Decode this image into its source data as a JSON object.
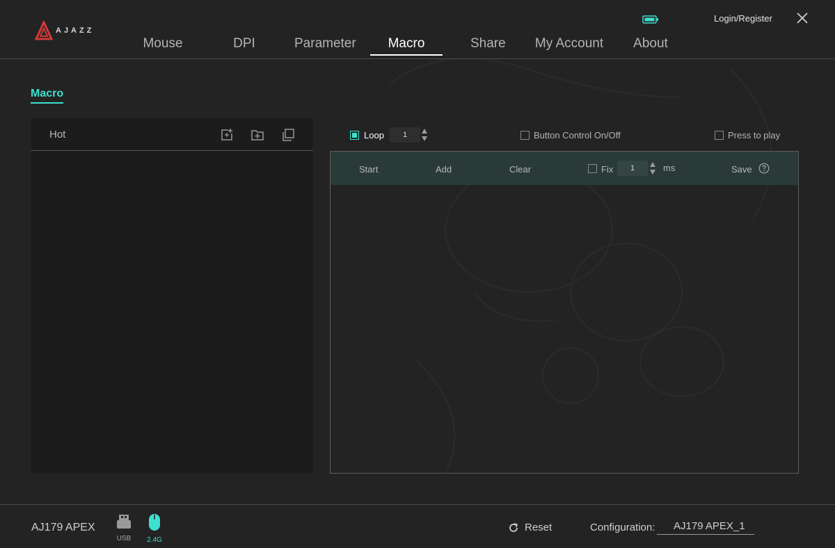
{
  "header": {
    "logo_text": "AJAZZ",
    "login_label": "Login/Register",
    "tabs": [
      {
        "label": "Mouse"
      },
      {
        "label": "DPI"
      },
      {
        "label": "Parameter"
      },
      {
        "label": "Macro",
        "active": true
      },
      {
        "label": "Share"
      },
      {
        "label": "My Account"
      },
      {
        "label": "About"
      }
    ]
  },
  "section": {
    "title": "Macro"
  },
  "macro_list": {
    "header": "Hot",
    "icons": [
      "add-macro-icon",
      "add-folder-icon",
      "copy-icon"
    ]
  },
  "options": {
    "loop_label": "Loop",
    "loop_checked": true,
    "loop_count": "1",
    "button_control_label": "Button Control On/Off",
    "button_control_checked": false,
    "press_to_play_label": "Press to play",
    "press_to_play_checked": false
  },
  "editor": {
    "start_label": "Start",
    "add_label": "Add",
    "clear_label": "Clear",
    "fix_label": "Fix",
    "fix_checked": false,
    "fix_value": "1",
    "unit_label": "ms",
    "save_label": "Save"
  },
  "footer": {
    "device_name": "AJ179 APEX",
    "usb_label": "USB",
    "wireless_label": "2.4G",
    "reset_label": "Reset",
    "config_label": "Configuration:",
    "config_value": "AJ179 APEX_1"
  },
  "colors": {
    "accent": "#3ee0d0",
    "background": "#232323",
    "panel": "#1c1c1c",
    "editor_bar": "#2a3a38"
  }
}
